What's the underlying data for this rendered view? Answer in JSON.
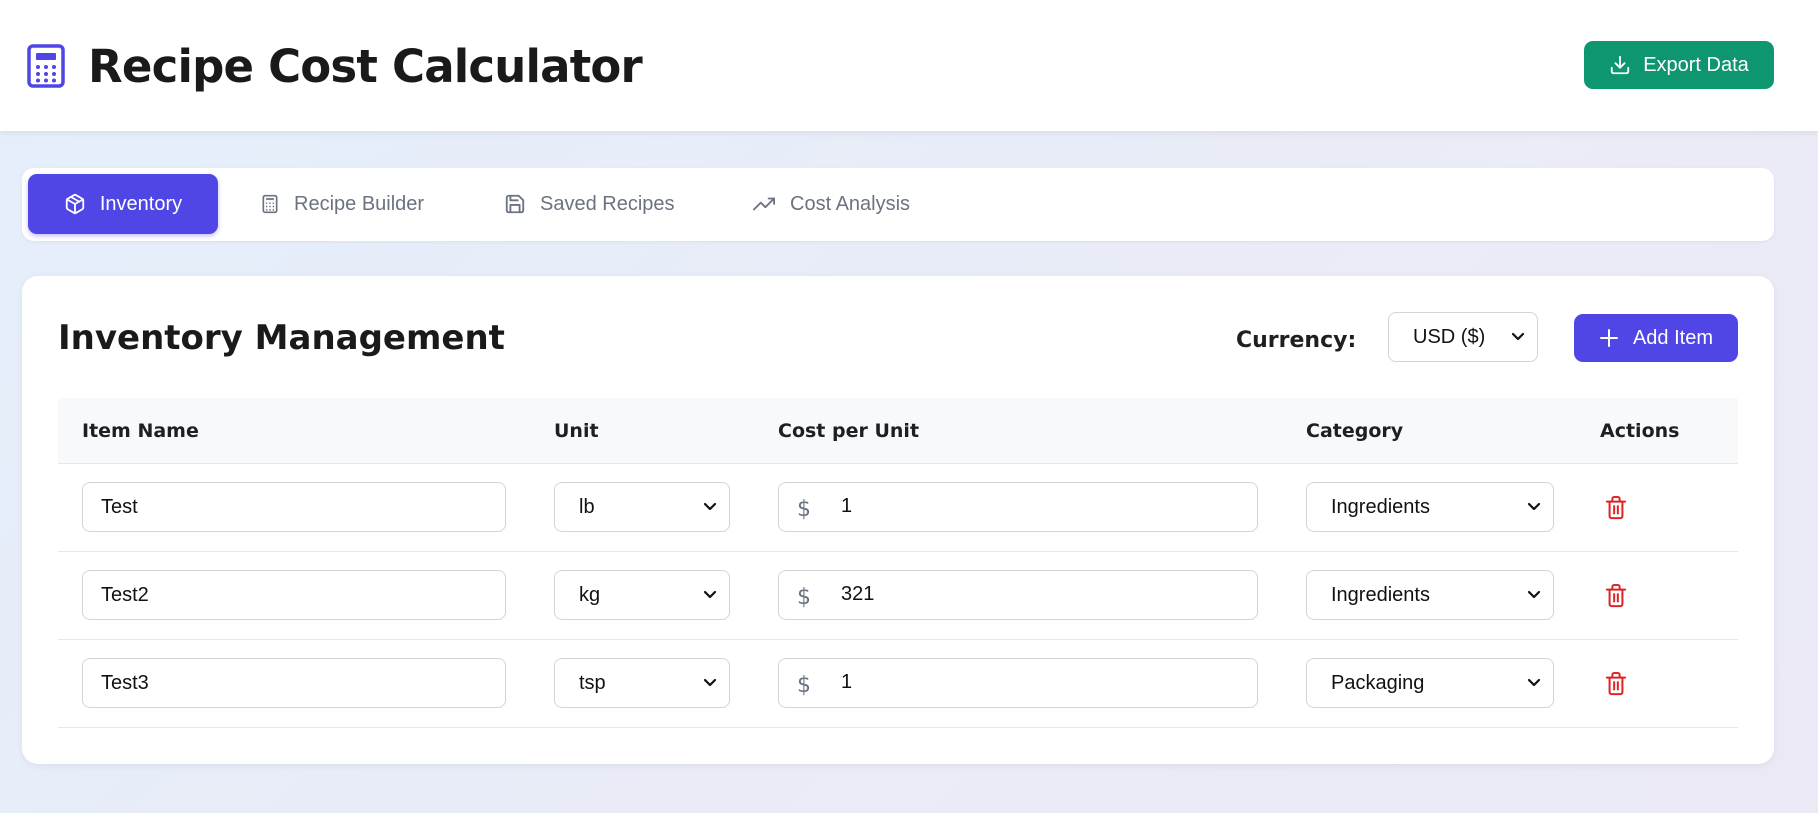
{
  "app": {
    "title": "Recipe Cost Calculator",
    "export_label": "Export Data"
  },
  "tabs": [
    {
      "label": "Inventory",
      "icon": "box-icon",
      "active": true
    },
    {
      "label": "Recipe Builder",
      "icon": "calculator-icon",
      "active": false
    },
    {
      "label": "Saved Recipes",
      "icon": "save-icon",
      "active": false
    },
    {
      "label": "Cost Analysis",
      "icon": "trending-up-icon",
      "active": false
    }
  ],
  "inventory": {
    "title": "Inventory Management",
    "currency_label": "Currency:",
    "currency_value": "USD ($)",
    "add_label": "Add Item",
    "columns": [
      "Item Name",
      "Unit",
      "Cost per Unit",
      "Category",
      "Actions"
    ],
    "currency_symbol": "$",
    "rows": [
      {
        "name": "Test",
        "unit": "lb",
        "cost": "1",
        "category": "Ingredients"
      },
      {
        "name": "Test2",
        "unit": "kg",
        "cost": "321",
        "category": "Ingredients"
      },
      {
        "name": "Test3",
        "unit": "tsp",
        "cost": "1",
        "category": "Packaging"
      }
    ]
  },
  "colors": {
    "primary": "#4f46e5",
    "export_green": "#0e9670",
    "delete_red": "#dc2626",
    "muted_text": "#6b7280"
  }
}
